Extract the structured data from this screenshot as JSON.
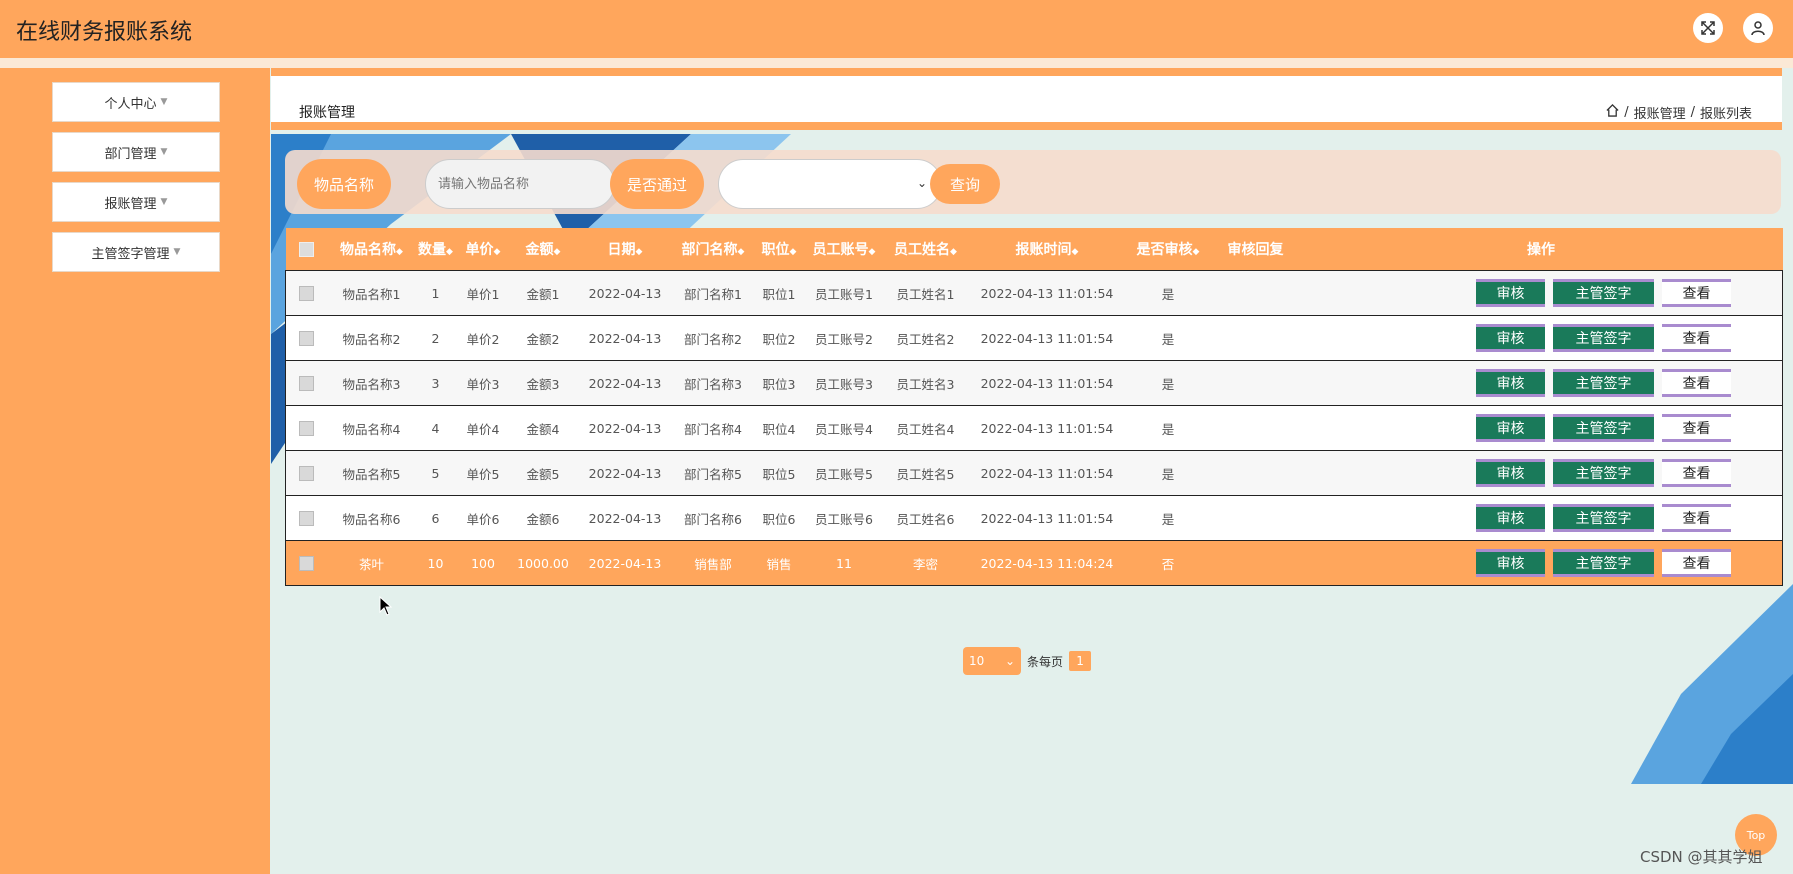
{
  "app": {
    "title": "在线财务报账系统"
  },
  "sidebar": {
    "items": [
      {
        "label": "个人中心"
      },
      {
        "label": "部门管理"
      },
      {
        "label": "报账管理"
      },
      {
        "label": "主管签字管理"
      }
    ]
  },
  "page": {
    "title": "报账管理",
    "breadcrumb": [
      "报账管理",
      "报账列表"
    ]
  },
  "search": {
    "name_label": "物品名称",
    "name_placeholder": "请输入物品名称",
    "pass_label": "是否通过",
    "pass_value": "",
    "query_label": "查询"
  },
  "table": {
    "headers": [
      "物品名称",
      "数量",
      "单价",
      "金额",
      "日期",
      "部门名称",
      "职位",
      "员工账号",
      "员工姓名",
      "报账时间",
      "是否审核",
      "审核回复",
      "操作"
    ],
    "rows": [
      [
        "物品名称1",
        "1",
        "单价1",
        "金额1",
        "2022-04-13",
        "部门名称1",
        "职位1",
        "员工账号1",
        "员工姓名1",
        "2022-04-13 11:01:54",
        "是",
        ""
      ],
      [
        "物品名称2",
        "2",
        "单价2",
        "金额2",
        "2022-04-13",
        "部门名称2",
        "职位2",
        "员工账号2",
        "员工姓名2",
        "2022-04-13 11:01:54",
        "是",
        ""
      ],
      [
        "物品名称3",
        "3",
        "单价3",
        "金额3",
        "2022-04-13",
        "部门名称3",
        "职位3",
        "员工账号3",
        "员工姓名3",
        "2022-04-13 11:01:54",
        "是",
        ""
      ],
      [
        "物品名称4",
        "4",
        "单价4",
        "金额4",
        "2022-04-13",
        "部门名称4",
        "职位4",
        "员工账号4",
        "员工姓名4",
        "2022-04-13 11:01:54",
        "是",
        ""
      ],
      [
        "物品名称5",
        "5",
        "单价5",
        "金额5",
        "2022-04-13",
        "部门名称5",
        "职位5",
        "员工账号5",
        "员工姓名5",
        "2022-04-13 11:01:54",
        "是",
        ""
      ],
      [
        "物品名称6",
        "6",
        "单价6",
        "金额6",
        "2022-04-13",
        "部门名称6",
        "职位6",
        "员工账号6",
        "员工姓名6",
        "2022-04-13 11:01:54",
        "是",
        ""
      ],
      [
        "茶叶",
        "10",
        "100",
        "1000.00",
        "2022-04-13",
        "销售部",
        "销售",
        "11",
        "李密",
        "2022-04-13 11:04:24",
        "否",
        ""
      ]
    ],
    "actions": {
      "audit": "审核",
      "sign": "主管签字",
      "view": "查看"
    }
  },
  "pagination": {
    "page_size": "10",
    "per_page_label": "条每页",
    "current_page": "1"
  },
  "misc": {
    "top_label": "Top",
    "watermark": "CSDN @其其学姐"
  },
  "colors": {
    "accent": "#ffa65c",
    "action_green": "#1a7a5a",
    "background": "#e3f0ec"
  }
}
